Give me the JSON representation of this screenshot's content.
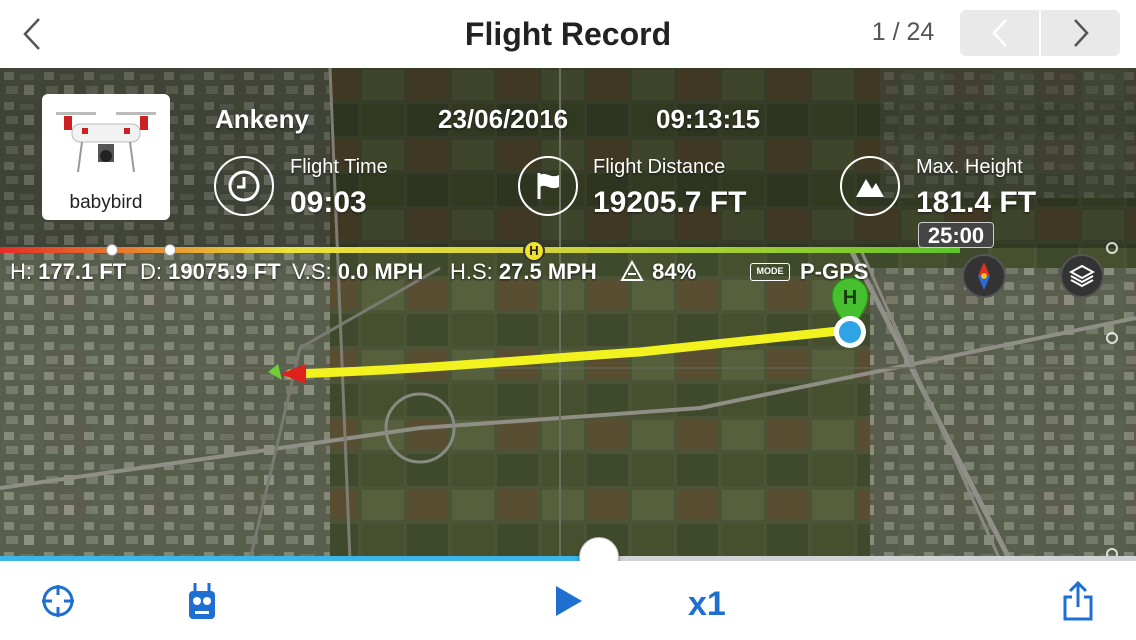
{
  "header": {
    "title": "Flight Record",
    "counter": "1 / 24"
  },
  "aircraft": {
    "name": "babybird"
  },
  "flight": {
    "location": "Ankeny",
    "date": "23/06/2016",
    "time": "09:13:15"
  },
  "stats": [
    {
      "label": "Flight Time",
      "value": "09:03",
      "icon": "clock-icon"
    },
    {
      "label": "Flight Distance",
      "value": "19205.7 FT",
      "icon": "flag-icon"
    },
    {
      "label": "Max. Height",
      "value": "181.4 FT",
      "icon": "mountain-icon"
    }
  ],
  "timeline": {
    "total": "25:00",
    "home_marker": "H"
  },
  "telemetry": {
    "h_label": "H:",
    "h_value": "177.1 FT",
    "d_label": "D:",
    "d_value": "19075.9 FT",
    "vs_label": "V.S:",
    "vs_value": "0.0 MPH",
    "hs_label": "H.S:",
    "hs_value": "27.5 MPH",
    "battery_value": "84%",
    "mode_badge": "MODE",
    "mode_value": "P-GPS"
  },
  "map": {
    "home_pin": "H",
    "flight_path_color": "#f2f21f"
  },
  "playback": {
    "progress_fraction": 0.527,
    "speed": "x1"
  },
  "colors": {
    "accent": "#1f6fd1",
    "progress": "#3ab6e8"
  }
}
